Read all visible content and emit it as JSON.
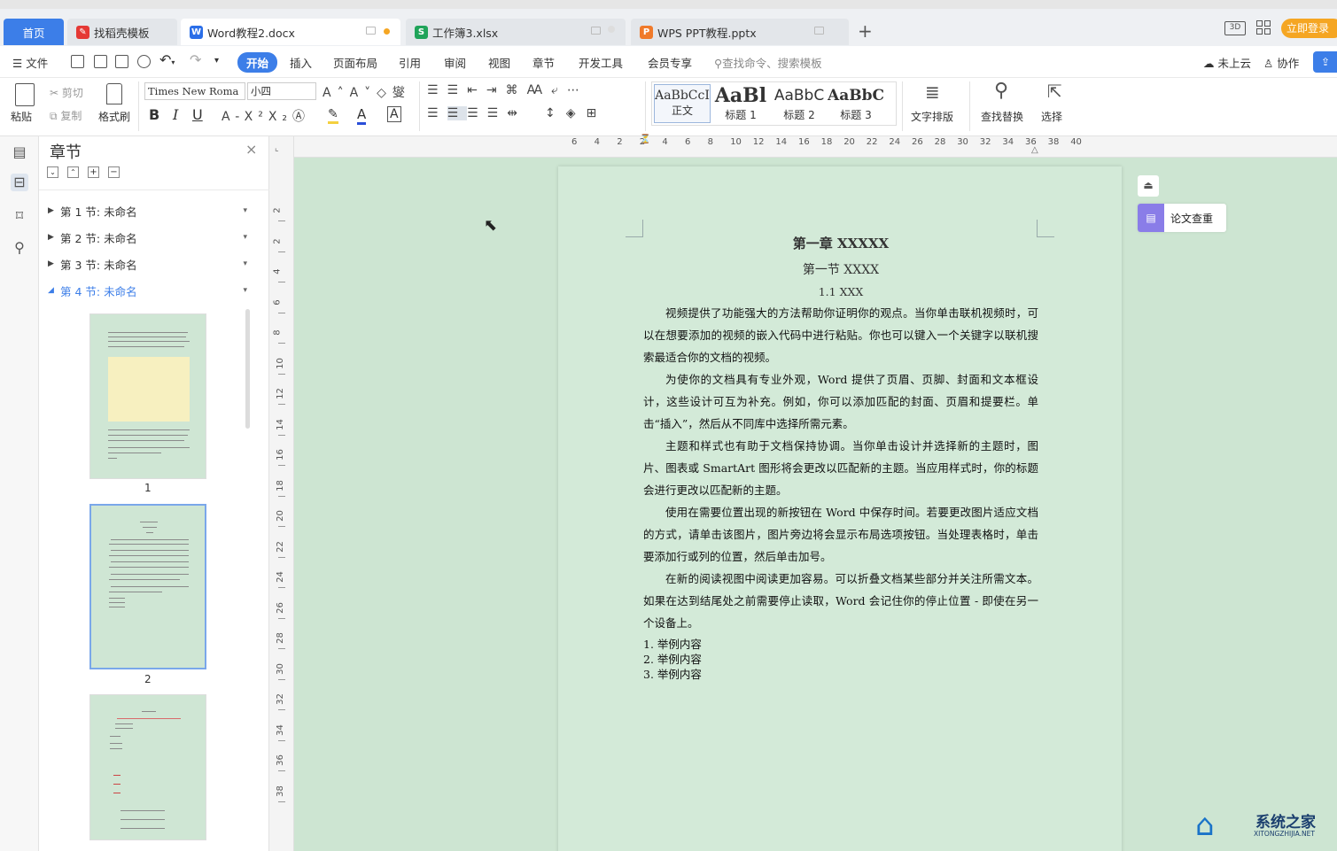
{
  "tabs": [
    {
      "label": "首页",
      "active": false,
      "icon": "home"
    },
    {
      "label": "找稻壳模板",
      "icon": "docer-icon",
      "color": "#e53935"
    },
    {
      "label": "Word教程2.docx",
      "icon": "word-icon",
      "color": "#2a6ee8",
      "active": true
    },
    {
      "label": "工作簿3.xlsx",
      "icon": "excel-icon",
      "color": "#20a45a"
    },
    {
      "label": "WPS PPT教程.pptx",
      "icon": "ppt-icon",
      "color": "#f07a2a"
    }
  ],
  "tab_add": "+",
  "login_button": "立即登录",
  "menu": {
    "file": "文件",
    "items": [
      "开始",
      "插入",
      "页面布局",
      "引用",
      "审阅",
      "视图",
      "章节",
      "开发工具",
      "会员专享"
    ],
    "search": "查找命令、搜索模板",
    "cloud": "未上云",
    "collab": "协作"
  },
  "ribbon": {
    "paste": "粘贴",
    "cut": "剪切",
    "copy": "复制",
    "format_painter": "格式刷",
    "font_name": "Times New Roma",
    "font_size": "小四",
    "styles": [
      {
        "preview": "AaBbCcI",
        "label": "正文"
      },
      {
        "preview": "AaBl",
        "label": "标题 1"
      },
      {
        "preview": "AaBbC",
        "label": "标题 2"
      },
      {
        "preview": "AaBbC",
        "label": "标题 3"
      }
    ],
    "text_layout": "文字排版",
    "find_replace": "查找替换",
    "select": "选择"
  },
  "panel": {
    "title": "章节",
    "sections": [
      "第 1 节: 未命名",
      "第 2 节: 未命名",
      "第 3 节: 未命名",
      "第 4 节: 未命名"
    ],
    "active_section": 3,
    "page_labels": [
      "1",
      "2"
    ]
  },
  "ruler_h": [
    "6",
    "4",
    "2",
    "2",
    "4",
    "6",
    "8",
    "10",
    "12",
    "14",
    "16",
    "18",
    "20",
    "22",
    "24",
    "26",
    "28",
    "30",
    "32",
    "34",
    "36",
    "38",
    "40"
  ],
  "ruler_v": [
    "2",
    "2",
    "4",
    "6",
    "8",
    "10",
    "12",
    "14",
    "16",
    "18",
    "20",
    "22",
    "24",
    "26",
    "28",
    "30",
    "32",
    "34",
    "36",
    "38"
  ],
  "plagiarism_check": "论文查重",
  "doc": {
    "h1": "第一章 XXXXX",
    "h2": "第一节 XXXX",
    "h3": "1.1 XXX",
    "paragraphs": [
      "视频提供了功能强大的方法帮助你证明你的观点。当你单击联机视频时，可以在想要添加的视频的嵌入代码中进行粘贴。你也可以键入一个关键字以联机搜索最适合你的文档的视频。",
      "为使你的文档具有专业外观，Word 提供了页眉、页脚、封面和文本框设计，这些设计可互为补充。例如，你可以添加匹配的封面、页眉和提要栏。单击“插入”，然后从不同库中选择所需元素。",
      "主题和样式也有助于文档保持协调。当你单击设计并选择新的主题时，图片、图表或 SmartArt 图形将会更改以匹配新的主题。当应用样式时，你的标题会进行更改以匹配新的主题。",
      "使用在需要位置出现的新按钮在 Word 中保存时间。若要更改图片适应文档的方式，请单击该图片，图片旁边将会显示布局选项按钮。当处理表格时，单击要添加行或列的位置，然后单击加号。",
      "在新的阅读视图中阅读更加容易。可以折叠文档某些部分并关注所需文本。如果在达到结尾处之前需要停止读取，Word 会记住你的停止位置 - 即使在另一个设备上。"
    ],
    "list": [
      "1. 举例内容",
      "2. 举例内容",
      "3. 举例内容"
    ]
  },
  "watermark": {
    "title": "系统之家",
    "sub": "XITONGZHIJIA.NET"
  },
  "colors": {
    "accent": "#3c7ee8",
    "page": "#d3ead8",
    "canvas": "#cde5d2",
    "login": "#f5a623"
  }
}
